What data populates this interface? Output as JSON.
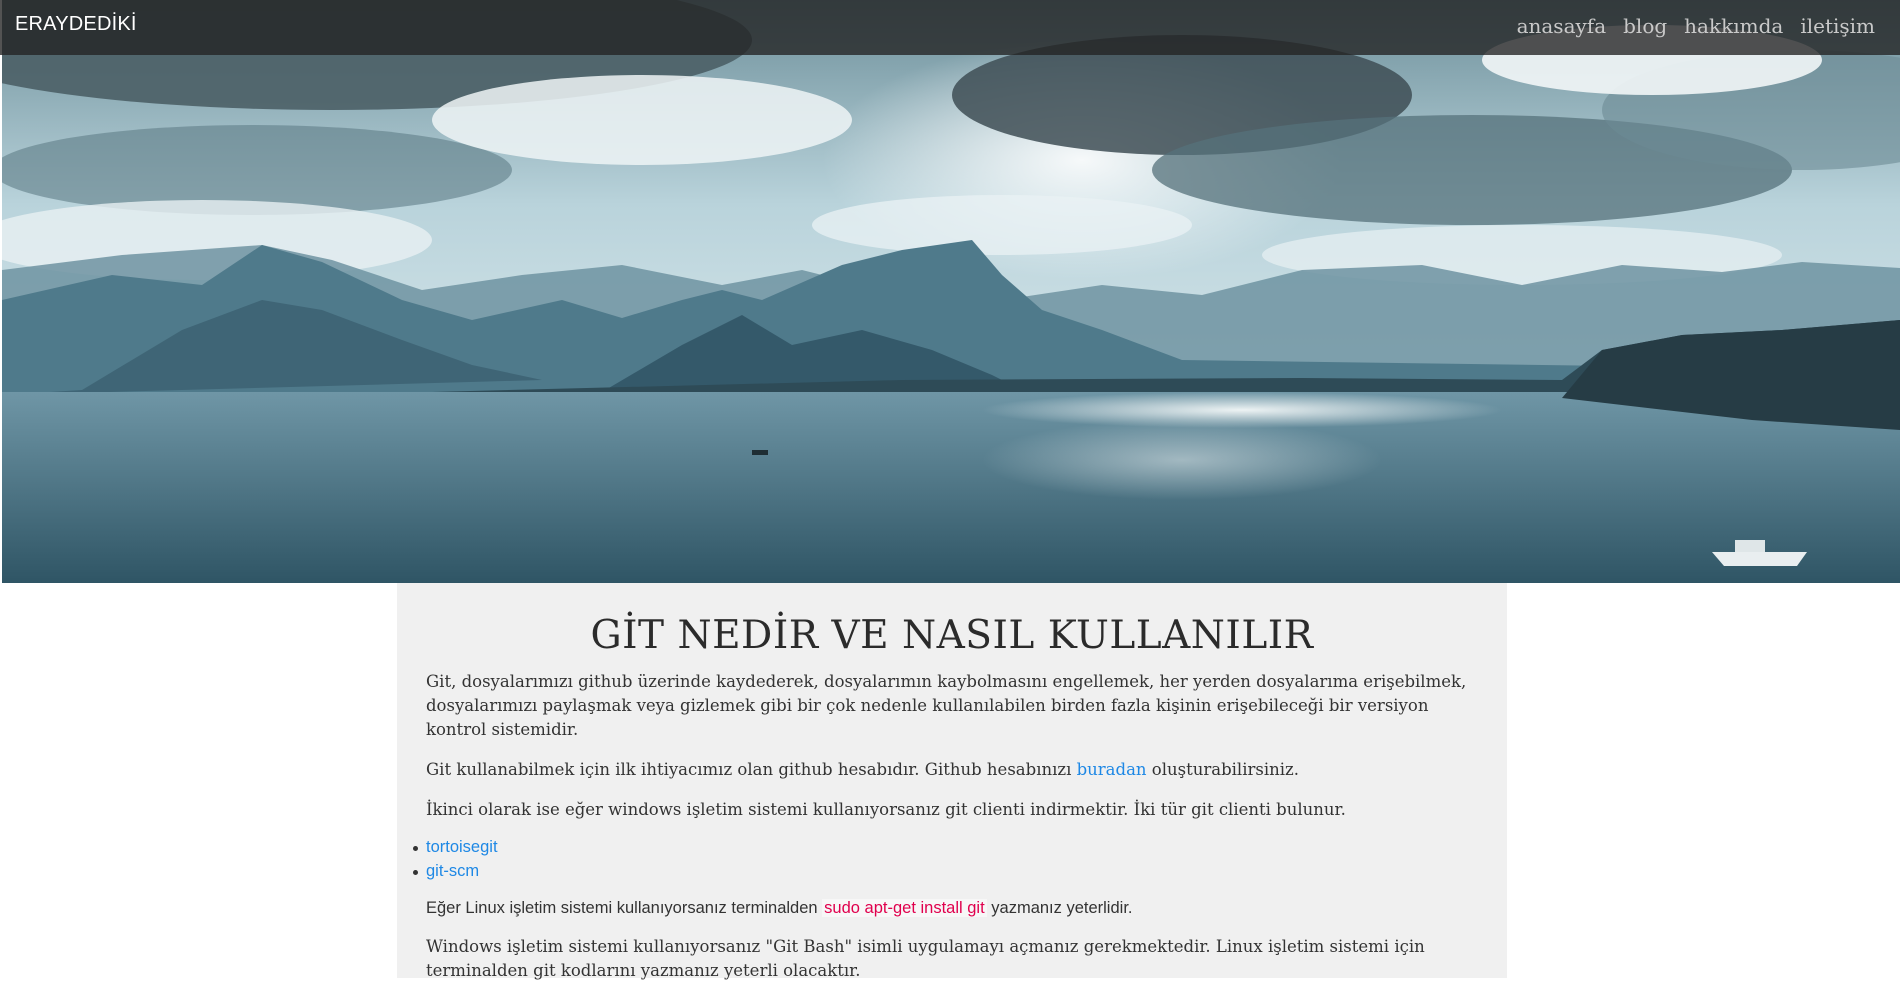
{
  "navbar": {
    "brand": "ERAYDEDİKİ",
    "links": [
      "anasayfa",
      "blog",
      "hakkımda",
      "iletişim"
    ]
  },
  "hero": {
    "image": "landscape of mountains, sea and cloudy sky"
  },
  "article": {
    "title": "GİT NEDİR VE NASIL KULLANILIR",
    "p1": "Git, dosyalarımızı github üzerinde kaydederek, dosyalarımın kaybolmasını engellemek, her yerden dosyalarıma erişebilmek, dosyalarımızı paylaşmak veya gizlemek gibi bir çok nedenle kullanılabilen birden fazla kişinin erişebileceği bir versiyon kontrol sistemidir.",
    "p2_before": "Git kullanabilmek için ilk ihtiyacımız olan github hesabıdır. Github hesabınızı ",
    "p2_link": "buradan",
    "p2_after": " oluşturabilirsiniz.",
    "p3": "İkinci olarak ise eğer windows işletim sistemi kullanıyorsanız git clienti indirmektir. İki tür git clienti bulunur.",
    "clients": [
      "tortoisegit",
      "git-scm"
    ],
    "p4_before": "Eğer Linux işletim sistemi kullanıyorsanız terminalden ",
    "p4_code": "sudo apt-get install git",
    "p4_after": " yazmanız yeterlidir.",
    "p5": "Windows işletim sistemi kullanıyorsanız \"Git Bash\" isimli uygulamayı açmanız gerekmektedir. Linux işletim sistemi için terminalden git kodlarını yazmanız yeterli olacaktır."
  },
  "colors": {
    "link": "#1e88e5",
    "code": "#e0004d",
    "content_bg": "#f0f0f0",
    "navbar_bg": "#2a2a2a"
  }
}
